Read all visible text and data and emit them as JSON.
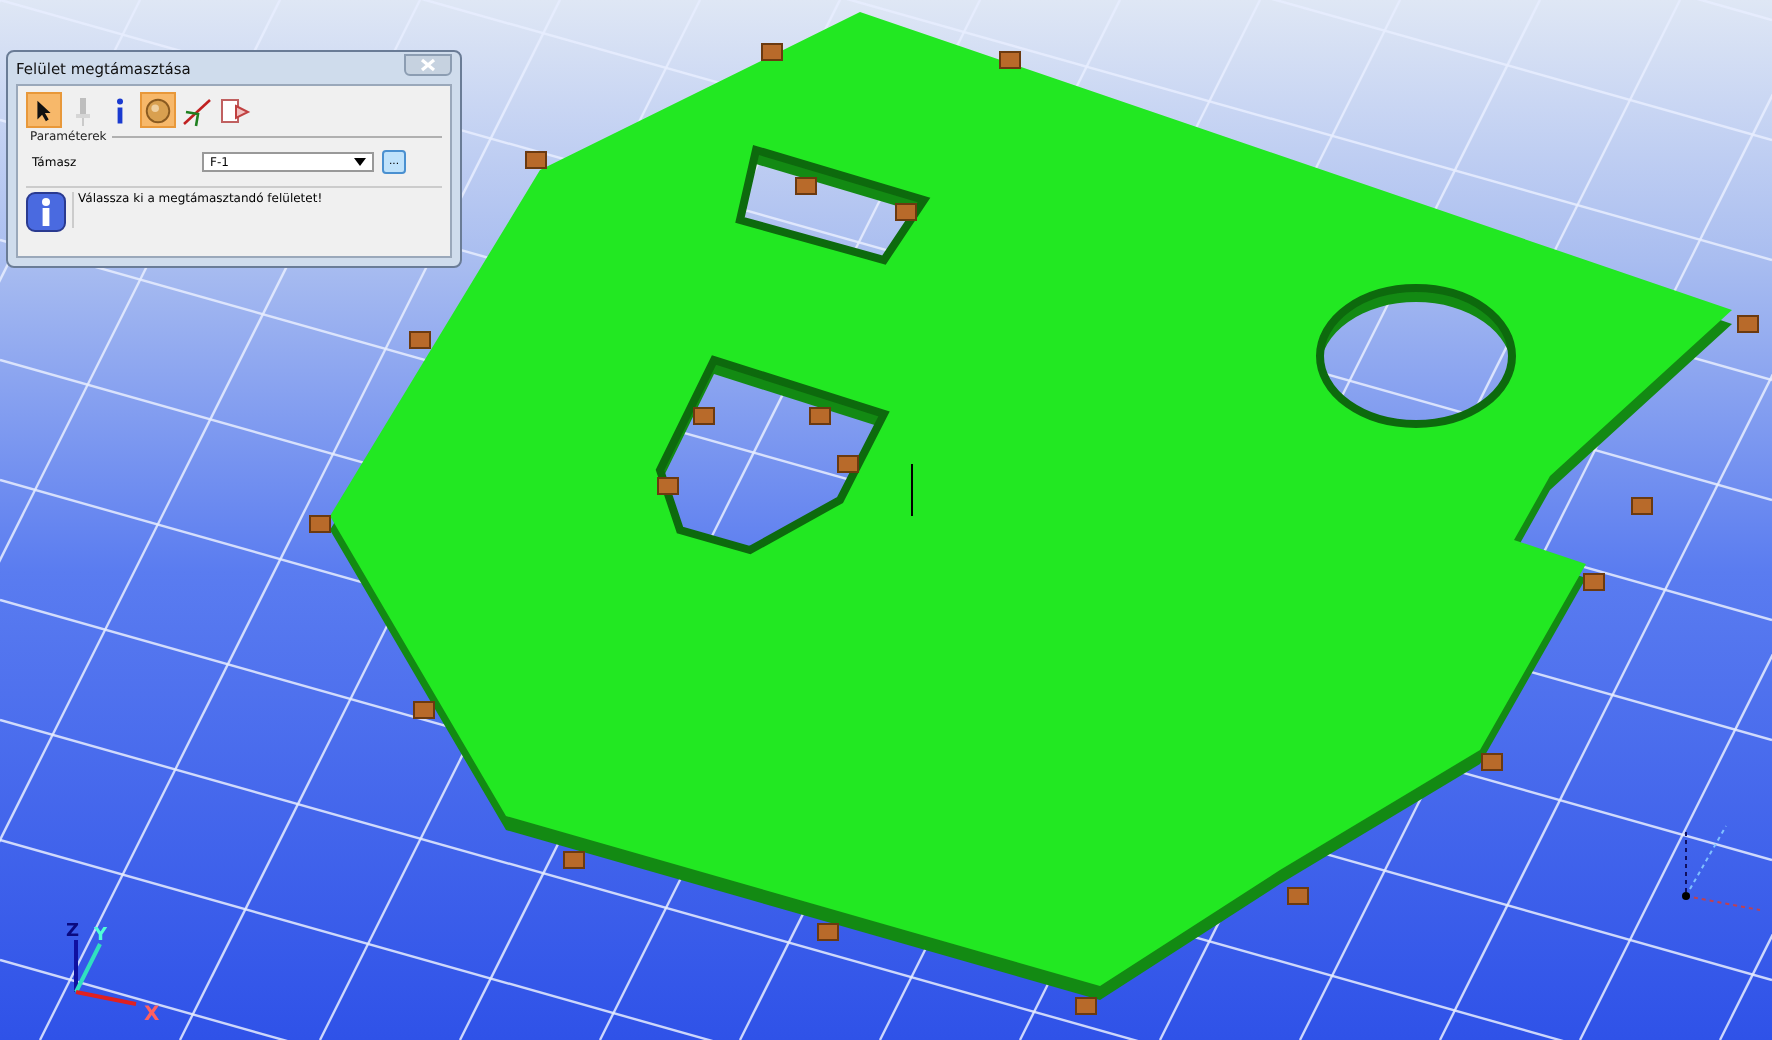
{
  "dialog": {
    "title": "Felület megtámasztása",
    "tools": [
      {
        "kind": "pointer",
        "selected": true,
        "disabled": false
      },
      {
        "kind": "pin",
        "selected": false,
        "disabled": true
      },
      {
        "kind": "info",
        "selected": false,
        "disabled": false
      },
      {
        "kind": "sphere",
        "selected": true,
        "disabled": false
      },
      {
        "kind": "axes",
        "selected": false,
        "disabled": false
      },
      {
        "kind": "export",
        "selected": false,
        "disabled": false
      }
    ],
    "group_label": "Paraméterek",
    "support": {
      "label": "Támasz",
      "value": "F-1",
      "browse_button": "..."
    },
    "message": "Válassza ki a megtámasztandó felületet!"
  },
  "axes": {
    "z": "Z",
    "y": "Y",
    "x": "X"
  }
}
